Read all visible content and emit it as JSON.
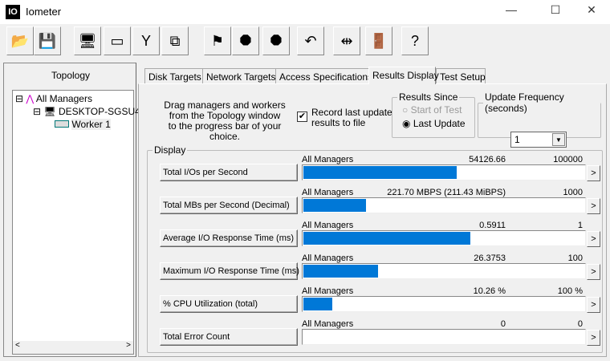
{
  "window": {
    "title": "Iometer",
    "icon": "IO"
  },
  "toolbar": [
    {
      "name": "open-icon",
      "glyph": "📂"
    },
    {
      "name": "save-icon",
      "glyph": "💾"
    },
    {
      "name": "new-manager-icon",
      "glyph": "🖥"
    },
    {
      "name": "new-disk-worker-icon",
      "glyph": "▭"
    },
    {
      "name": "new-network-worker-icon",
      "glyph": "Y"
    },
    {
      "name": "duplicate-worker-icon",
      "glyph": "⧉"
    },
    {
      "name": "start-flag-icon",
      "glyph": "⚑"
    },
    {
      "name": "stop-icon",
      "glyph": "⯃"
    },
    {
      "name": "stop-all-icon",
      "glyph": "⯃"
    },
    {
      "name": "reset-workers-icon",
      "glyph": "↶"
    },
    {
      "name": "disconnect-icon",
      "glyph": "⇹"
    },
    {
      "name": "exit-icon",
      "glyph": "🚪"
    },
    {
      "name": "help-icon",
      "glyph": "?"
    }
  ],
  "topology": {
    "title": "Topology",
    "items": [
      "All Managers",
      "DESKTOP-SGSU4",
      "Worker 1"
    ]
  },
  "tabs": [
    "Disk Targets",
    "Network Targets",
    "Access Specifications",
    "Results Display",
    "Test Setup"
  ],
  "active_tab": 3,
  "instructions": [
    "Drag managers and workers",
    "from the Topology window",
    "to the progress bar of your choice."
  ],
  "record": {
    "label1": "Record last update",
    "label2": "results to file",
    "checked": true
  },
  "results_since": {
    "title": "Results Since",
    "options": [
      "Start of Test",
      "Last Update"
    ],
    "selected": 1
  },
  "update_frequency": {
    "title": "Update Frequency (seconds)",
    "value": "1"
  },
  "display": {
    "title": "Display",
    "rows": [
      {
        "button": "Total I/Os per Second",
        "source": "All Managers",
        "value": "54126.66",
        "max": "100000",
        "fraction": 0.5413
      },
      {
        "button": "Total MBs per Second (Decimal)",
        "source": "All Managers",
        "value": "221.70 MBPS (211.43 MiBPS)",
        "max": "1000",
        "fraction": 0.2217
      },
      {
        "button": "Average I/O Response Time (ms)",
        "source": "All Managers",
        "value": "0.5911",
        "max": "1",
        "fraction": 0.5911
      },
      {
        "button": "Maximum I/O Response Time (ms)",
        "source": "All Managers",
        "value": "26.3753",
        "max": "100",
        "fraction": 0.2638
      },
      {
        "button": "% CPU Utilization (total)",
        "source": "All Managers",
        "value": "10.26 %",
        "max": "100 %",
        "fraction": 0.1026
      },
      {
        "button": "Total Error Count",
        "source": "All Managers",
        "value": "0",
        "max": "0",
        "fraction": 0
      }
    ]
  }
}
